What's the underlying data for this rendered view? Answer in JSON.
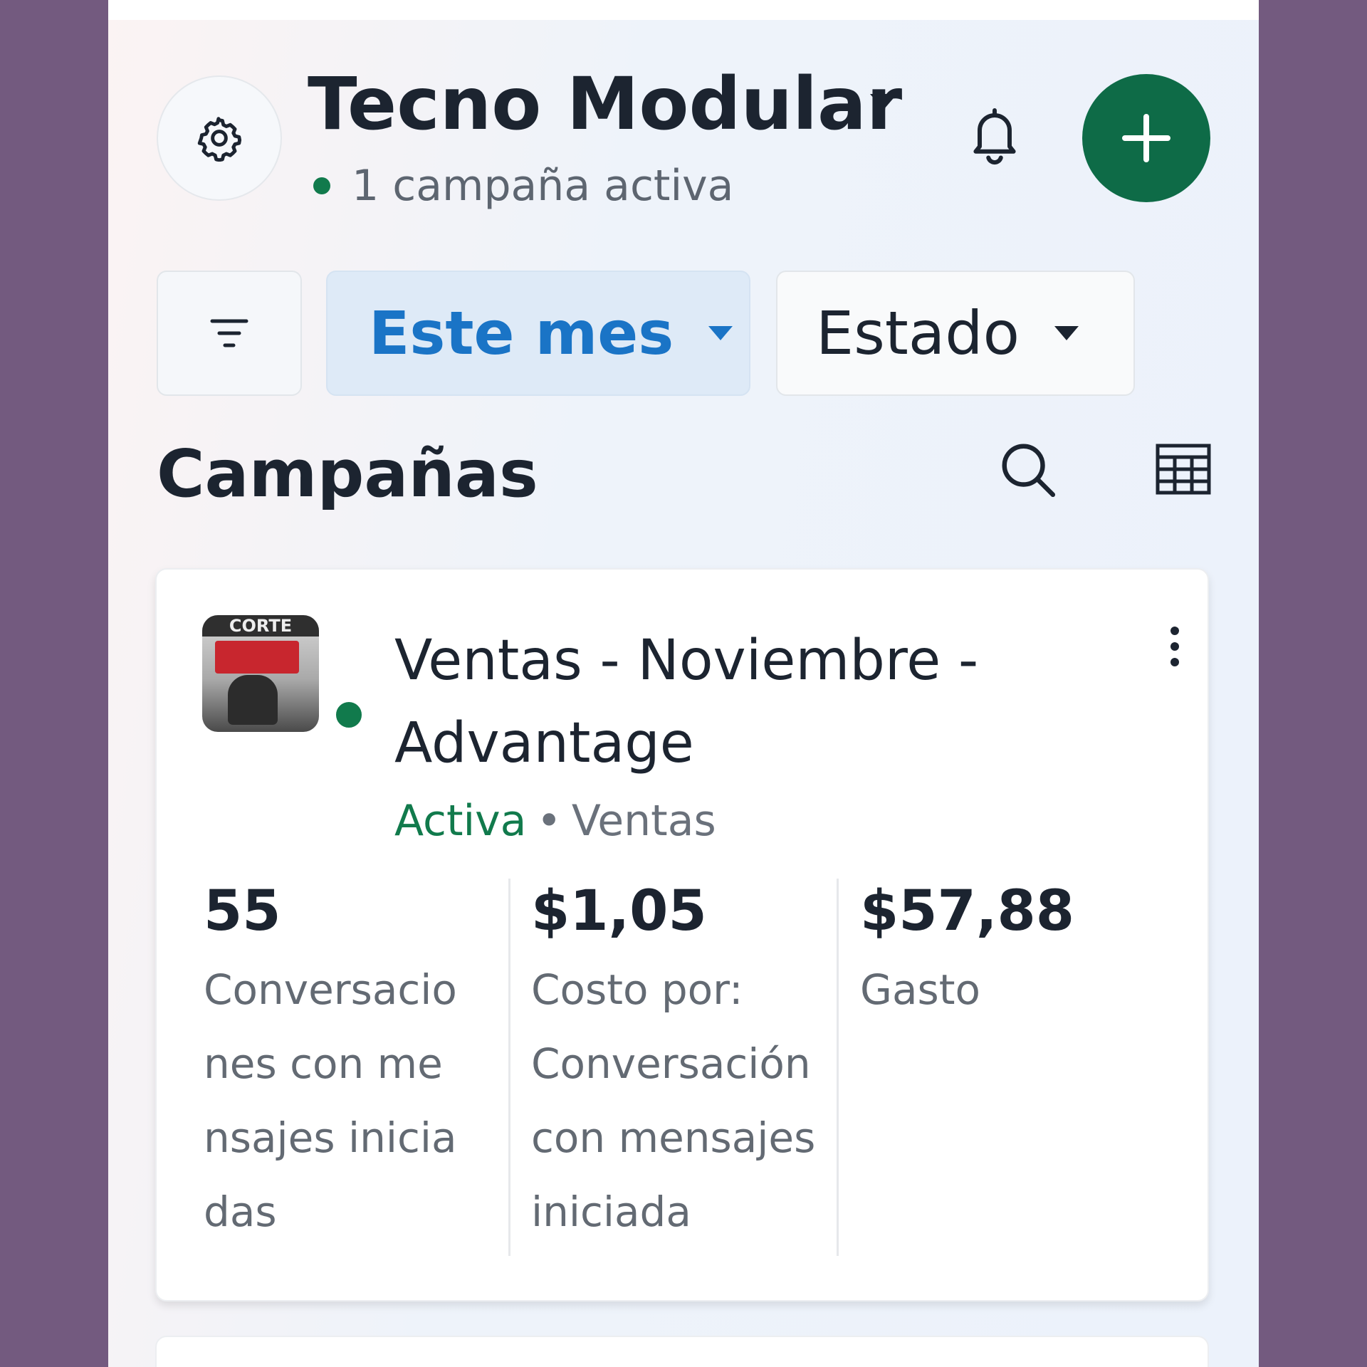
{
  "header": {
    "account_name": "Tecno Modular",
    "active_status": "1 campaña activa",
    "icons": {
      "settings": "gear-icon",
      "account_menu": "caret-down-icon",
      "notifications": "bell-icon",
      "create": "plus-icon"
    }
  },
  "filters": {
    "filter_icon": "filter-icon",
    "date_range": "Este mes",
    "status": "Estado"
  },
  "section": {
    "title": "Campañas",
    "icons": {
      "search": "search-icon",
      "view_toggle": "table-icon"
    }
  },
  "campaign": {
    "name": "Ventas - Noviembre - Advantage",
    "status": "Activa",
    "separator": "•",
    "objective": "Ventas",
    "thumbnail_text": "CORTE",
    "metrics": [
      {
        "value": "55",
        "label": "Conversaciones con mensajes iniciadas"
      },
      {
        "value": "$1,05",
        "label": "Costo por: Conversación con mensajes iniciada"
      },
      {
        "value": "$57,88",
        "label": "Gasto"
      }
    ]
  },
  "colors": {
    "brand_green": "#0e6b47",
    "active_green": "#117a4c",
    "link_blue": "#1a74c6",
    "frame_purple": "#735a7f"
  }
}
